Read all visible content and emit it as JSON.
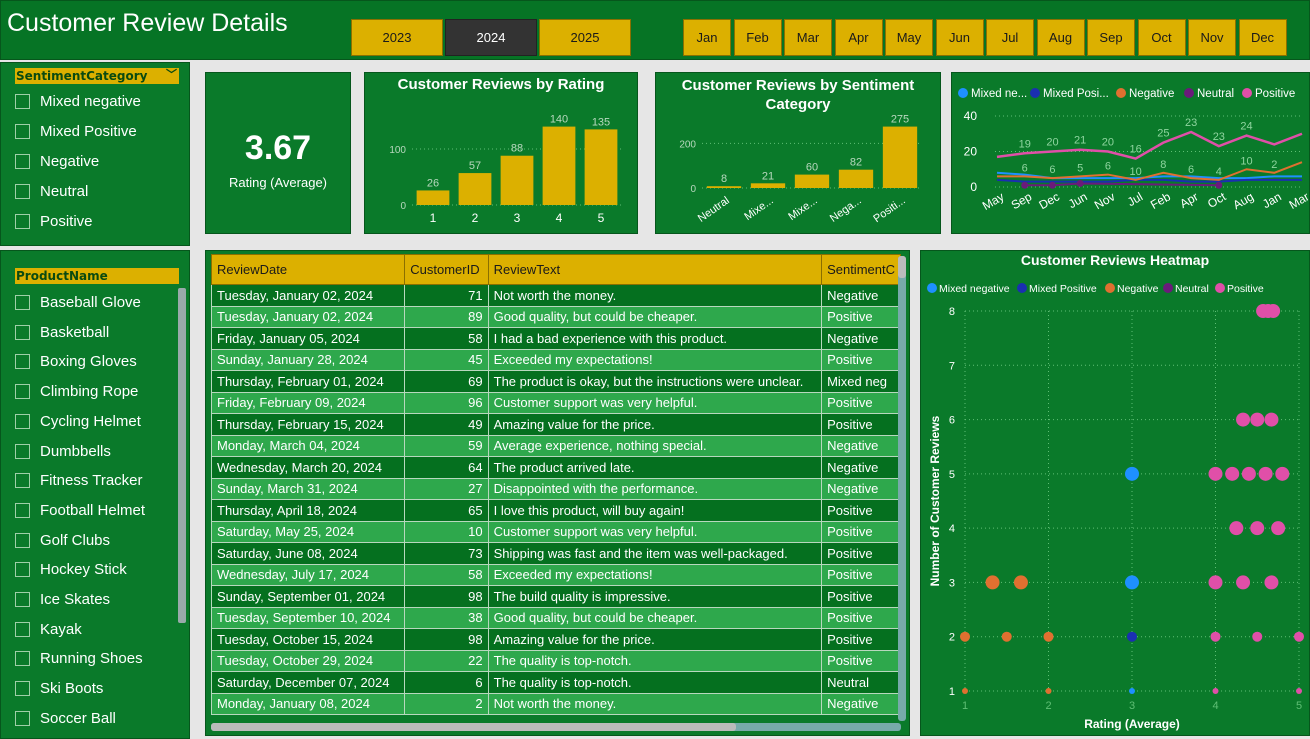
{
  "header": {
    "title": "Customer Review Details",
    "years": [
      {
        "label": "2023",
        "selected": false
      },
      {
        "label": "2024",
        "selected": true
      },
      {
        "label": "2025",
        "selected": false
      }
    ],
    "months": [
      "Jan",
      "Feb",
      "Mar",
      "Apr",
      "May",
      "Jun",
      "Jul",
      "Aug",
      "Sep",
      "Oct",
      "Nov",
      "Dec"
    ]
  },
  "sentiment_slicer": {
    "title": "SentimentCategory",
    "items": [
      "Mixed negative",
      "Mixed Positive",
      "Negative",
      "Neutral",
      "Positive"
    ]
  },
  "product_slicer": {
    "title": "ProductName",
    "items": [
      "Baseball Glove",
      "Basketball",
      "Boxing Gloves",
      "Climbing Rope",
      "Cycling Helmet",
      "Dumbbells",
      "Fitness Tracker",
      "Football Helmet",
      "Golf Clubs",
      "Hockey Stick",
      "Ice Skates",
      "Kayak",
      "Running Shoes",
      "Ski Boots",
      "Soccer Ball"
    ]
  },
  "kpi": {
    "value": "3.67",
    "label": "Rating (Average)"
  },
  "colors": {
    "accent": "#dcb000",
    "panel": "#0a7a2a",
    "mixed_negative": "#1e90ff",
    "mixed_positive": "#1a2fb0",
    "negative": "#e07030",
    "neutral": "#6a1b7a",
    "positive": "#e04fa8"
  },
  "chart_data": [
    {
      "type": "bar",
      "title": "Customer Reviews by Rating",
      "categories": [
        "1",
        "2",
        "3",
        "4",
        "5"
      ],
      "values": [
        26,
        57,
        88,
        140,
        135
      ],
      "yticks": [
        "0",
        "100"
      ],
      "ylim": [
        0,
        150
      ]
    },
    {
      "type": "bar",
      "title": "Customer Reviews by Sentiment Category",
      "categories": [
        "Neutral",
        "Mixe...",
        "Mixe...",
        "Nega...",
        "Positi..."
      ],
      "values": [
        8,
        21,
        60,
        82,
        275
      ],
      "yticks": [
        "0",
        "200"
      ],
      "ylim": [
        0,
        300
      ]
    },
    {
      "type": "line",
      "legend": [
        "Mixed ne...",
        "Mixed Posi...",
        "Negative",
        "Neutral",
        "Positive"
      ],
      "x": [
        "May",
        "Sep",
        "Dec",
        "Jun",
        "Nov",
        "Jul",
        "Feb",
        "Apr",
        "Oct",
        "Aug",
        "Jan",
        "Mar"
      ],
      "yticks": [
        "0",
        "20",
        "40"
      ],
      "ylim": [
        0,
        40
      ],
      "positive_labels": [
        "19",
        "20",
        "21",
        "20",
        "16",
        "25",
        "23",
        "23",
        "24"
      ],
      "negative_labels": [
        "6",
        "6",
        "5",
        "6",
        "10",
        "8",
        "6",
        "4",
        "10",
        "2"
      ],
      "series": [
        {
          "name": "Mixed ne...",
          "values": [
            8,
            7,
            5,
            5,
            5,
            5,
            6,
            6,
            5,
            5,
            6,
            6
          ]
        },
        {
          "name": "Mixed Posi...",
          "values": [
            4,
            3,
            3,
            3,
            3,
            4,
            4,
            3,
            3,
            4,
            4,
            4
          ]
        },
        {
          "name": "Negative",
          "values": [
            6,
            6,
            5,
            6,
            7,
            4,
            8,
            5,
            4,
            10,
            8,
            14
          ]
        },
        {
          "name": "Neutral",
          "values": [
            null,
            1,
            1,
            2,
            null,
            null,
            null,
            null,
            1,
            null,
            null,
            null
          ]
        },
        {
          "name": "Positive",
          "values": [
            17,
            19,
            20,
            21,
            20,
            16,
            25,
            31,
            23,
            29,
            24,
            30
          ]
        }
      ]
    },
    {
      "type": "scatter",
      "title": "Customer Reviews Heatmap",
      "legend": [
        "Mixed negative",
        "Mixed Positive",
        "Negative",
        "Neutral",
        "Positive"
      ],
      "xlabel": "Rating (Average)",
      "ylabel": "Number of Customer Reviews",
      "xticks": [
        "1",
        "2",
        "3",
        "4",
        "5"
      ],
      "yticks": [
        "1",
        "2",
        "3",
        "4",
        "5",
        "6",
        "7",
        "8"
      ],
      "points": [
        {
          "s": "Negative",
          "x": 1,
          "y": 1
        },
        {
          "s": "Negative",
          "x": 2,
          "y": 1
        },
        {
          "s": "Mixed negative",
          "x": 3,
          "y": 1
        },
        {
          "s": "Positive",
          "x": 4,
          "y": 1
        },
        {
          "s": "Positive",
          "x": 5,
          "y": 1
        },
        {
          "s": "Negative",
          "x": 1,
          "y": 2
        },
        {
          "s": "Negative",
          "x": 1.5,
          "y": 2
        },
        {
          "s": "Negative",
          "x": 2,
          "y": 2
        },
        {
          "s": "Mixed Positive",
          "x": 3,
          "y": 2
        },
        {
          "s": "Positive",
          "x": 4,
          "y": 2
        },
        {
          "s": "Positive",
          "x": 4.5,
          "y": 2
        },
        {
          "s": "Positive",
          "x": 5,
          "y": 2
        },
        {
          "s": "Negative",
          "x": 1.33,
          "y": 3
        },
        {
          "s": "Negative",
          "x": 1.67,
          "y": 3
        },
        {
          "s": "Mixed negative",
          "x": 3,
          "y": 3
        },
        {
          "s": "Positive",
          "x": 4,
          "y": 3
        },
        {
          "s": "Positive",
          "x": 4.33,
          "y": 3
        },
        {
          "s": "Positive",
          "x": 4.67,
          "y": 3
        },
        {
          "s": "Positive",
          "x": 4.25,
          "y": 4
        },
        {
          "s": "Positive",
          "x": 4.5,
          "y": 4
        },
        {
          "s": "Positive",
          "x": 4.75,
          "y": 4
        },
        {
          "s": "Mixed negative",
          "x": 3,
          "y": 5
        },
        {
          "s": "Positive",
          "x": 4,
          "y": 5
        },
        {
          "s": "Positive",
          "x": 4.2,
          "y": 5
        },
        {
          "s": "Positive",
          "x": 4.4,
          "y": 5
        },
        {
          "s": "Positive",
          "x": 4.6,
          "y": 5
        },
        {
          "s": "Positive",
          "x": 4.8,
          "y": 5
        },
        {
          "s": "Positive",
          "x": 4.33,
          "y": 6
        },
        {
          "s": "Positive",
          "x": 4.5,
          "y": 6
        },
        {
          "s": "Positive",
          "x": 4.67,
          "y": 6
        },
        {
          "s": "Positive",
          "x": 4.57,
          "y": 8
        },
        {
          "s": "Positive",
          "x": 4.63,
          "y": 8
        },
        {
          "s": "Positive",
          "x": 4.69,
          "y": 8
        }
      ]
    }
  ],
  "table": {
    "columns": [
      "ReviewDate",
      "CustomerID",
      "ReviewText",
      "SentimentC"
    ],
    "rows": [
      [
        "Tuesday, January 02, 2024",
        "71",
        "Not worth the money.",
        "Negative"
      ],
      [
        "Tuesday, January 02, 2024",
        "89",
        "Good quality, but could be cheaper.",
        "Positive"
      ],
      [
        "Friday, January 05, 2024",
        "58",
        "I had a bad experience with this product.",
        "Negative"
      ],
      [
        "Sunday, January 28, 2024",
        "45",
        "Exceeded my expectations!",
        "Positive"
      ],
      [
        "Thursday, February 01, 2024",
        "69",
        "The product is okay, but the instructions were unclear.",
        "Mixed neg"
      ],
      [
        "Friday, February 09, 2024",
        "96",
        "Customer support was very helpful.",
        "Positive"
      ],
      [
        "Thursday, February 15, 2024",
        "49",
        "Amazing value for the price.",
        "Positive"
      ],
      [
        "Monday, March 04, 2024",
        "59",
        "Average experience, nothing special.",
        "Negative"
      ],
      [
        "Wednesday, March 20, 2024",
        "64",
        "The product arrived late.",
        "Negative"
      ],
      [
        "Sunday, March 31, 2024",
        "27",
        "Disappointed with the performance.",
        "Negative"
      ],
      [
        "Thursday, April 18, 2024",
        "65",
        "I love this product, will buy again!",
        "Positive"
      ],
      [
        "Saturday, May 25, 2024",
        "10",
        "Customer support was very helpful.",
        "Positive"
      ],
      [
        "Saturday, June 08, 2024",
        "73",
        "Shipping was fast and the item was well-packaged.",
        "Positive"
      ],
      [
        "Wednesday, July 17, 2024",
        "58",
        "Exceeded my expectations!",
        "Positive"
      ],
      [
        "Sunday, September 01, 2024",
        "98",
        "The build quality is impressive.",
        "Positive"
      ],
      [
        "Tuesday, September 10, 2024",
        "38",
        "Good quality, but could be cheaper.",
        "Positive"
      ],
      [
        "Tuesday, October 15, 2024",
        "98",
        "Amazing value for the price.",
        "Positive"
      ],
      [
        "Tuesday, October 29, 2024",
        "22",
        "The quality is top-notch.",
        "Positive"
      ],
      [
        "Saturday, December 07, 2024",
        "6",
        "The quality is top-notch.",
        "Neutral"
      ],
      [
        "Monday, January 08, 2024",
        "2",
        "Not worth the money.",
        "Negative"
      ]
    ]
  }
}
